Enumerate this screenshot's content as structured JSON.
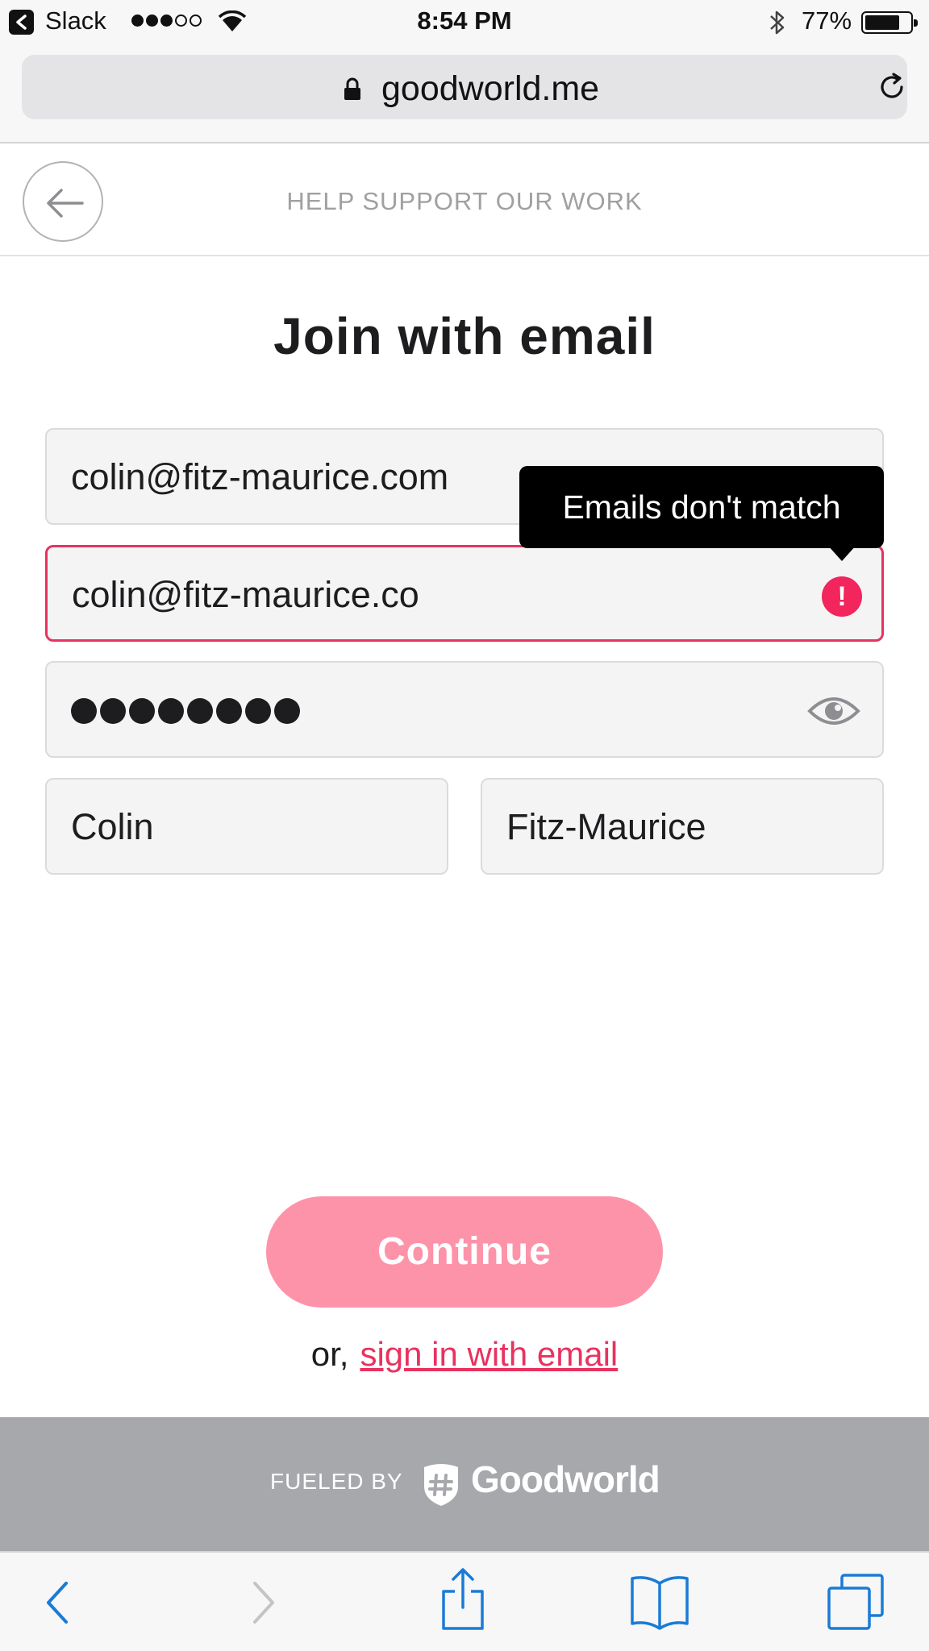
{
  "status_bar": {
    "back_app": "Slack",
    "time": "8:54 PM",
    "battery": "77%",
    "battery_level": 0.77,
    "signal_bars": 3,
    "signal_total": 5
  },
  "browser": {
    "url": "goodworld.me"
  },
  "header": {
    "title": "HELP SUPPORT OUR WORK"
  },
  "form": {
    "title": "Join with email",
    "email": "colin@fitz-maurice.com",
    "confirm_email": "colin@fitz-maurice.co",
    "error_tooltip": "Emails don't match",
    "password_dot_count": 8,
    "first_name": "Colin",
    "last_name": "Fitz-Maurice"
  },
  "actions": {
    "continue_label": "Continue",
    "or_text": "or,",
    "signin_link": "sign in with email"
  },
  "footer": {
    "fueled_by": "FUELED BY",
    "brand": "Goodworld"
  },
  "colors": {
    "accent": "#e8325f",
    "button_disabled": "#fd93a9",
    "footer_bg": "#a7a8ac",
    "ios_blue": "#1a7bd6"
  },
  "icons": [
    "back-arrow-icon",
    "lock-icon",
    "reload-icon",
    "error-icon",
    "eye-icon",
    "goodworld-logo-icon",
    "nav-back-icon",
    "nav-forward-icon",
    "share-icon",
    "bookmarks-icon",
    "tabs-icon"
  ]
}
